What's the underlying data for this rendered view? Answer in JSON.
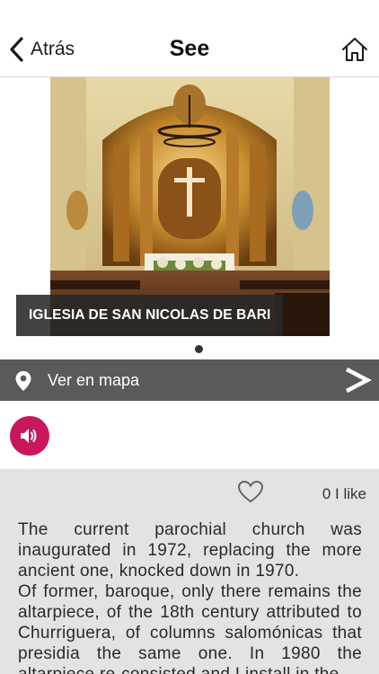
{
  "nav": {
    "back_label": "Atrás",
    "title": "See"
  },
  "gallery": {
    "caption": "IGLESIA DE SAN NICOLAS DE BARI",
    "page_count": 1,
    "current_page": 1
  },
  "map": {
    "label": "Ver en mapa"
  },
  "likes": {
    "count_label": "0 I like"
  },
  "description": {
    "text": "The current parochial church was inaugurated in 1972, replacing the more ancient one, knocked down in 1970.\nOf former, baroque, only there remains the altarpiece, of the 18th century attributed to Churriguera, of columns salomónicas that presidia the same one. In 1980 the altarpiece re-consisted and I install in the"
  },
  "colors": {
    "audio_accent": "#c8175d",
    "map_bar": "#5a5a5a",
    "content_bg": "#e3e3e3"
  },
  "icons": {
    "back": "chevron-left-icon",
    "home": "home-icon",
    "map_pin": "map-pin-icon",
    "forward": "chevron-right-icon",
    "audio": "speaker-icon",
    "like": "heart-icon"
  }
}
